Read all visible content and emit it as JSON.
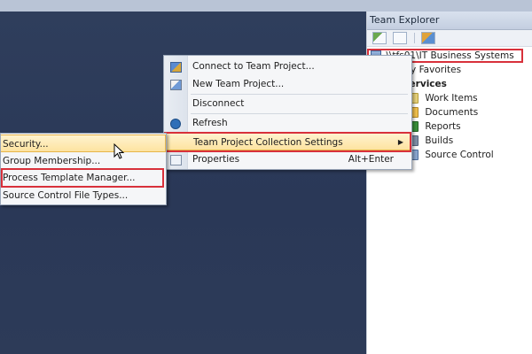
{
  "team_explorer": {
    "title": "Team Explorer",
    "tree": {
      "server": "\\\\tfs01\\IT Business Systems",
      "favorites": "My Favorites",
      "services_header": "Services",
      "services": [
        {
          "label": "Work Items",
          "icon": "work-items-icon"
        },
        {
          "label": "Documents",
          "icon": "documents-icon"
        },
        {
          "label": "Reports",
          "icon": "reports-icon"
        },
        {
          "label": "Builds",
          "icon": "builds-icon"
        },
        {
          "label": "Source Control",
          "icon": "source-control-icon"
        }
      ]
    }
  },
  "context_menu": {
    "items": [
      {
        "label": "Connect to Team Project...",
        "icon": "connect-icon"
      },
      {
        "label": "New Team Project...",
        "icon": "new-project-icon"
      },
      {
        "label": "Disconnect"
      },
      {
        "label": "Refresh",
        "icon": "refresh-icon"
      },
      {
        "label": "Team Project Collection Settings",
        "submenu": true,
        "active": true
      },
      {
        "label": "Properties",
        "shortcut": "Alt+Enter",
        "icon": "properties-icon"
      }
    ]
  },
  "submenu": {
    "items": [
      {
        "label": "Security...",
        "active": true
      },
      {
        "label": "Group Membership..."
      },
      {
        "label": "Process Template Manager..."
      },
      {
        "label": "Source Control File Types..."
      }
    ]
  },
  "colors": {
    "workspace": "#2b3a55",
    "highlight_border": "#d8313b",
    "menu_active": "#fde3a0"
  }
}
